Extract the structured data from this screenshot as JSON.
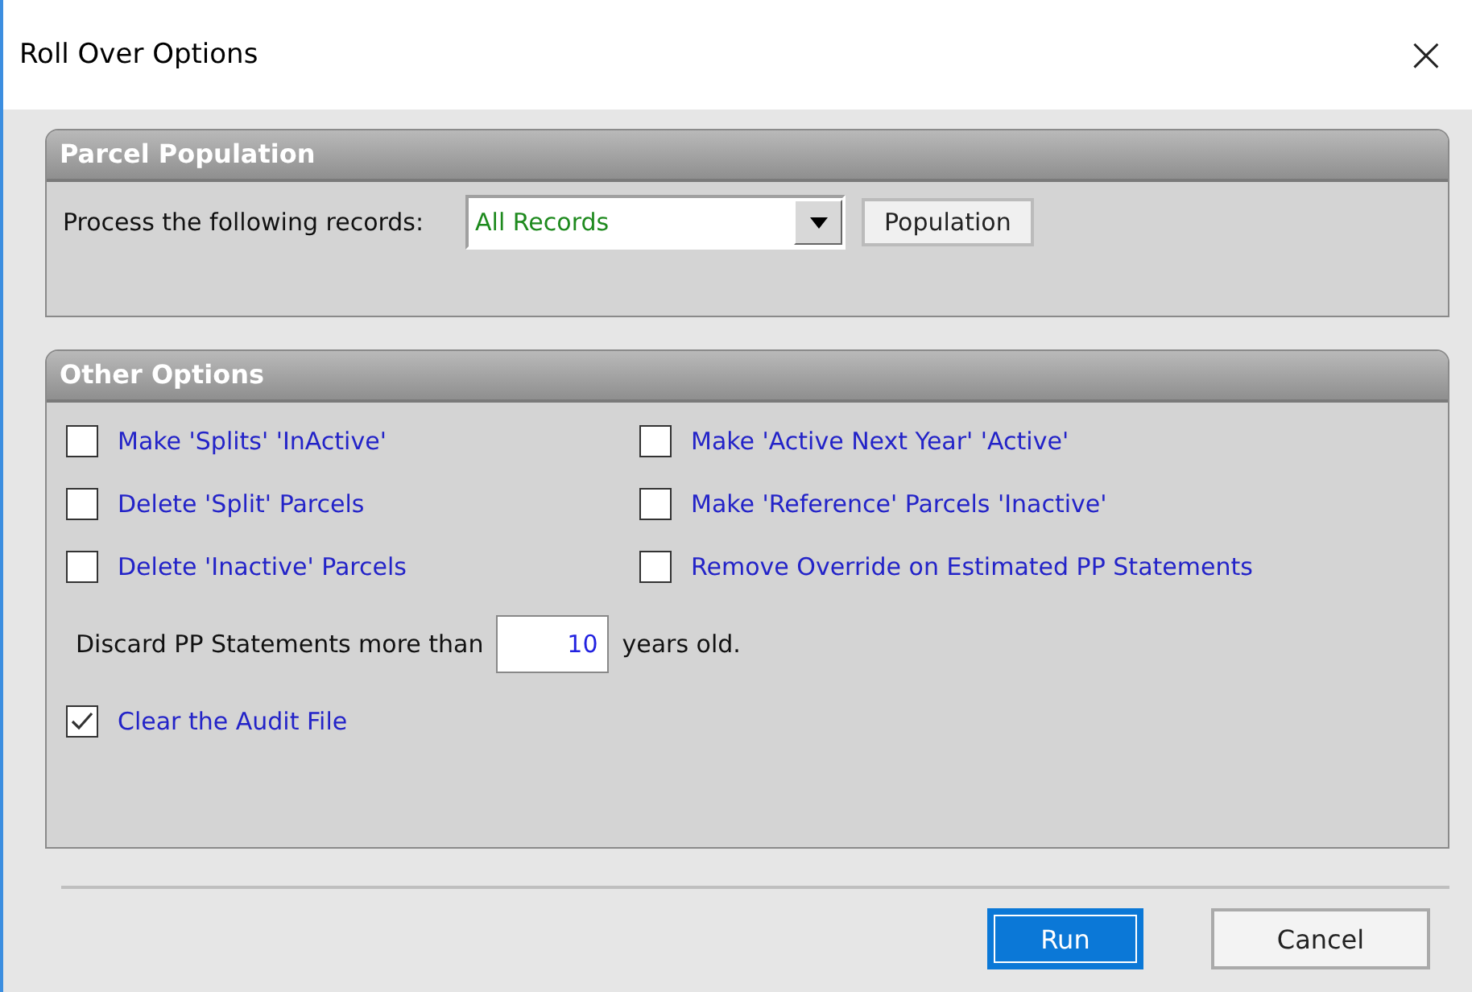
{
  "window": {
    "title": "Roll Over Options",
    "close": "×"
  },
  "parcel_population": {
    "title": "Parcel Population",
    "label": "Process the following records:",
    "records": {
      "value": "All Records"
    },
    "button": "Population"
  },
  "other_options": {
    "title": "Other Options",
    "options": [
      {
        "label": "Make 'Splits' 'InActive'",
        "checked": false
      },
      {
        "label": "Make 'Active Next Year' 'Active'",
        "checked": false
      },
      {
        "label": "Delete 'Split' Parcels",
        "checked": false
      },
      {
        "label": "Make 'Reference' Parcels 'Inactive'",
        "checked": false
      },
      {
        "label": "Delete 'Inactive' Parcels",
        "checked": false
      },
      {
        "label": "Remove Override on Estimated PP Statements",
        "checked": false
      }
    ],
    "discard": {
      "before": "Discard PP Statements more than",
      "value": "10",
      "after": "years old."
    },
    "audit": {
      "label": "Clear the Audit File",
      "checked": true
    }
  },
  "buttons": [
    {
      "label": "Run",
      "kind": "primary"
    },
    {
      "label": "Cancel",
      "kind": "normal"
    }
  ]
}
